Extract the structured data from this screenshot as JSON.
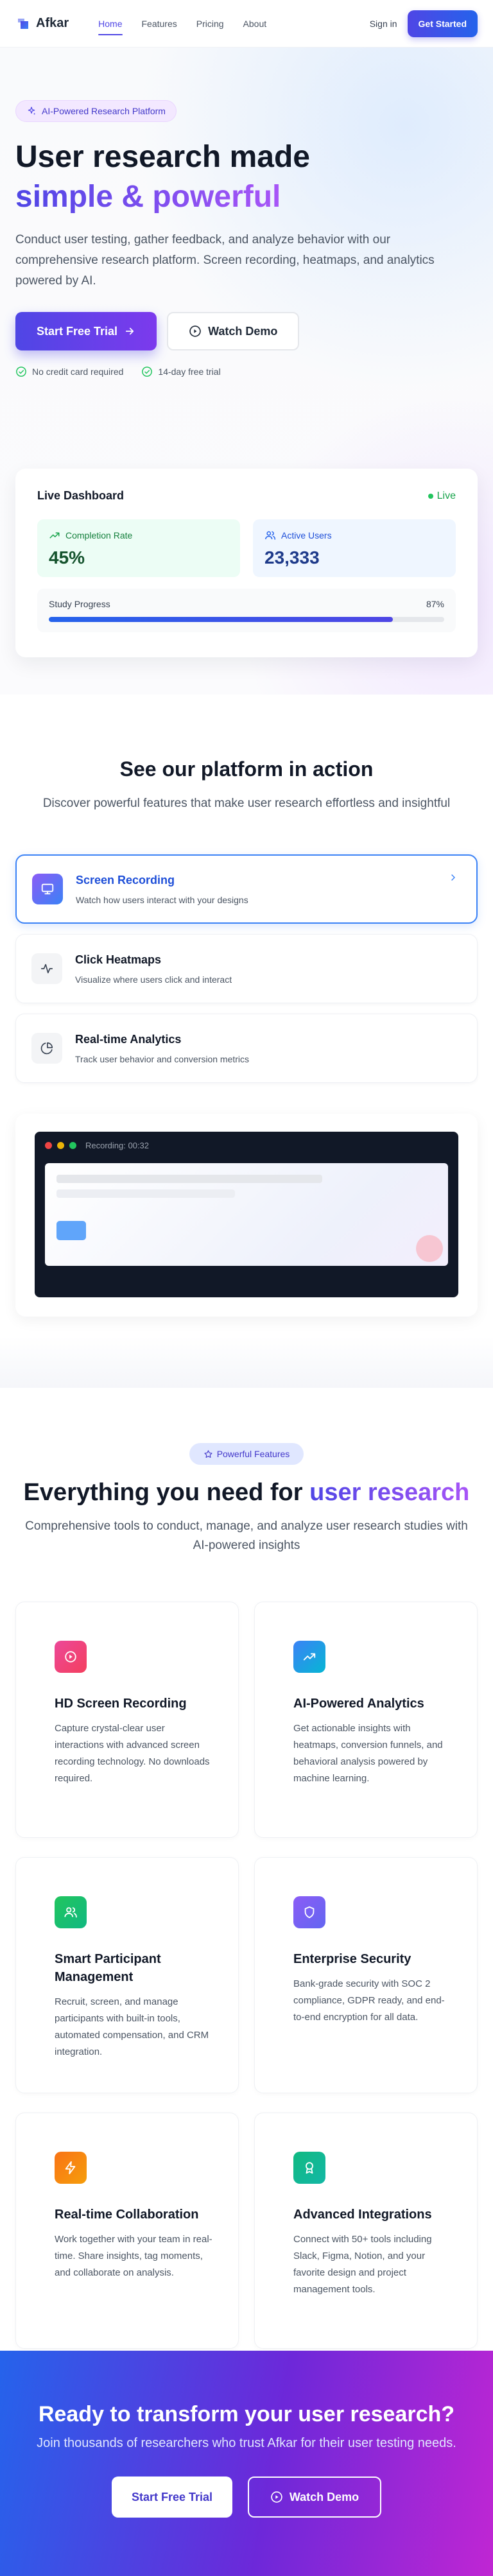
{
  "nav": {
    "brand": "Afkar",
    "links": [
      "Home",
      "Features",
      "Pricing",
      "About"
    ],
    "active_link": "Home",
    "signin": "Sign in",
    "cta": "Get Started"
  },
  "hero": {
    "badge": "AI-Powered Research Platform",
    "title_line1": "User research made",
    "title_line2": "simple & powerful",
    "description": "Conduct user testing, gather feedback, and analyze behavior with our comprehensive research platform. Screen recording, heatmaps, and analytics powered by AI.",
    "primary_button": "Start Free Trial",
    "secondary_button": "Watch Demo",
    "checks": [
      "No credit card required",
      "14-day free trial"
    ]
  },
  "dashboard": {
    "title": "Live Dashboard",
    "status": "Live",
    "completion_label": "Completion Rate",
    "completion_value": "45%",
    "users_label": "Active Users",
    "users_value": "23,333",
    "progress_label": "Study Progress",
    "progress_text": "87%",
    "progress_fraction": 0.87
  },
  "platform": {
    "title": "See our platform in action",
    "subtitle": "Discover powerful features that make user research effortless and insightful",
    "features": [
      {
        "title": "Screen Recording",
        "desc": "Watch how users interact with your designs"
      },
      {
        "title": "Click Heatmaps",
        "desc": "Visualize where users click and interact"
      },
      {
        "title": "Real-time Analytics",
        "desc": "Track user behavior and conversion metrics"
      }
    ],
    "recording_label": "Recording: 00:32"
  },
  "features": {
    "pill": "Powerful Features",
    "title_main": "Everything you need for",
    "title_highlight": "user research",
    "subtitle": "Comprehensive tools to conduct, manage, and analyze user research studies with AI-powered insights",
    "cards": [
      {
        "title": "HD Screen Recording",
        "desc": "Capture crystal-clear user interactions with advanced screen recording technology. No downloads required.",
        "icon": "play-circle-icon",
        "color": "#ec4899"
      },
      {
        "title": "AI-Powered Analytics",
        "desc": "Get actionable insights with heatmaps, conversion funnels, and behavioral analysis powered by machine learning.",
        "icon": "trending-up-icon",
        "color": "#3b82f6"
      },
      {
        "title": "Smart Participant Management",
        "desc": "Recruit, screen, and manage participants with built-in tools, automated compensation, and CRM integration.",
        "icon": "users-icon",
        "color": "#22c55e"
      },
      {
        "title": "Enterprise Security",
        "desc": "Bank-grade security with SOC 2 compliance, GDPR ready, and end-to-end encryption for all data.",
        "icon": "shield-icon",
        "color": "#8b5cf6"
      },
      {
        "title": "Real-time Collaboration",
        "desc": "Work together with your team in real-time. Share insights, tag moments, and collaborate on analysis.",
        "icon": "lightning-icon",
        "color": "#f97316"
      },
      {
        "title": "Advanced Integrations",
        "desc": "Connect with 50+ tools including Slack, Figma, Notion, and your favorite design and project management tools.",
        "icon": "award-icon",
        "color": "#10b981"
      }
    ]
  },
  "cta": {
    "title": "Ready to transform your user research?",
    "subtitle": "Join thousands of researchers who trust Afkar for their user testing needs.",
    "primary": "Start Free Trial",
    "secondary": "Watch Demo"
  }
}
